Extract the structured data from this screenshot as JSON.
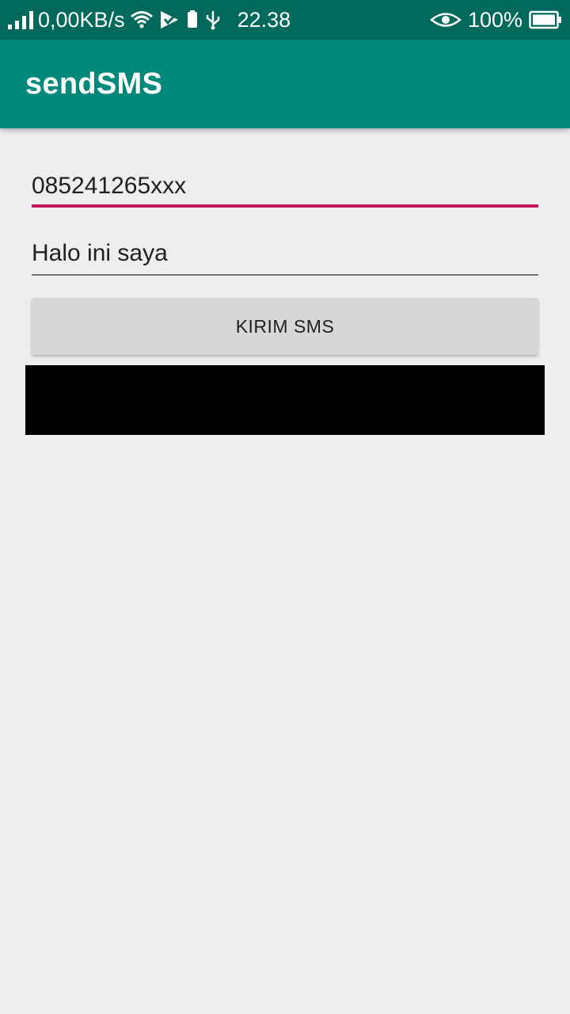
{
  "status_bar": {
    "net_speed": "0,00KB/s",
    "time": "22.38",
    "battery_percent": "100%",
    "icons": [
      "signal-icon",
      "wifi-icon",
      "checkmark-flag-icon",
      "sim-icon",
      "usb-icon",
      "eye-icon",
      "battery-icon"
    ]
  },
  "app_bar": {
    "title": "sendSMS",
    "color": "#00897b"
  },
  "form": {
    "phone_value": "085241265xxx",
    "message_value": "Halo ini saya",
    "send_label": "KIRIM SMS",
    "accent_color": "#c2185b"
  }
}
